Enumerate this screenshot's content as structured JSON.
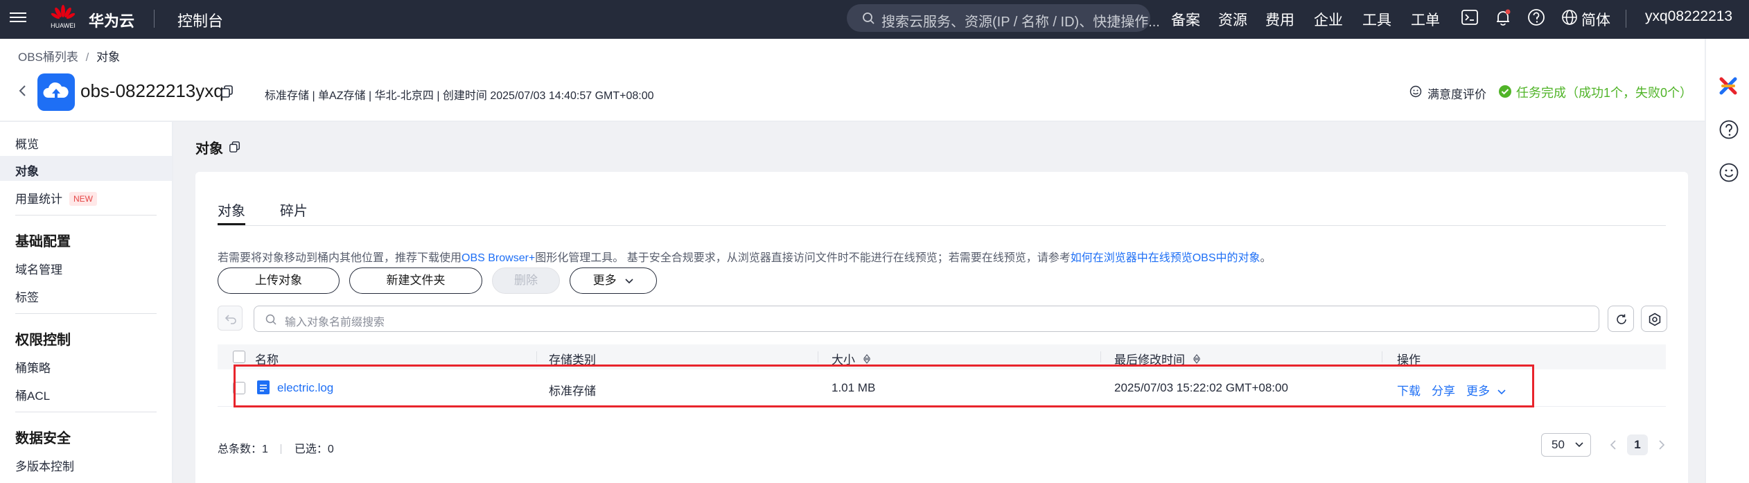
{
  "topbar": {
    "brand": "华为云",
    "logo_text": "HUAWEI",
    "console": "控制台",
    "search_placeholder": "搜索云服务、资源(IP / 名称 / ID)、快捷操作...",
    "nav": [
      "备案",
      "资源",
      "费用",
      "企业",
      "工具",
      "工单"
    ],
    "language": "简体",
    "user": "yxq08222213"
  },
  "header": {
    "breadcrumb_parent": "OBS桶列表",
    "breadcrumb_sep": "/",
    "breadcrumb_current": "对象",
    "bucket_name": "obs-08222213yxq",
    "meta": "标准存储 | 单AZ存储 | 华北-北京四 | 创建时间  2025/07/03 14:40:57 GMT+08:00",
    "satisfaction": "满意度评价",
    "task_status": "任务完成（成功1个，失败0个）"
  },
  "sidebar": {
    "items_top": [
      {
        "label": "概览"
      },
      {
        "label": "对象",
        "active": true
      },
      {
        "label": "用量统计",
        "badge": "NEW"
      }
    ],
    "groups": [
      {
        "title": "基础配置",
        "items": [
          "域名管理",
          "标签"
        ]
      },
      {
        "title": "权限控制",
        "items": [
          "桶策略",
          "桶ACL"
        ]
      },
      {
        "title": "数据安全",
        "items": [
          "多版本控制"
        ]
      }
    ]
  },
  "main": {
    "title": "对象",
    "tabs": [
      "对象",
      "碎片"
    ],
    "hint_prefix": "若需要将对象移动到桶内其他位置，推荐下载使用",
    "hint_link1": "OBS Browser+",
    "hint_middle": "图形化管理工具。 基于安全合规要求，从浏览器直接访问文件时不能进行在线预览；若需要在线预览，请参考",
    "hint_link2": "如何在浏览器中在线预览OBS中的对象",
    "hint_suffix": "。",
    "buttons": {
      "upload": "上传对象",
      "new_folder": "新建文件夹",
      "delete": "删除",
      "more": "更多"
    },
    "search_placeholder": "输入对象名前缀搜索",
    "columns": [
      "名称",
      "存储类别",
      "大小",
      "最后修改时间",
      "操作"
    ],
    "rows": [
      {
        "name": "electric.log",
        "storage_class": "标准存储",
        "size": "1.01 MB",
        "modified": "2025/07/03 15:22:02 GMT+08:00",
        "actions": [
          "下载",
          "分享",
          "更多"
        ]
      }
    ],
    "footer": {
      "total_label": "总条数：",
      "total": "1",
      "selected_label": "已选：",
      "selected": "0",
      "page_size": "50",
      "page": "1"
    }
  },
  "colors": {
    "accent": "#1e6ff5",
    "success": "#50b428",
    "highlight": "#e8242c",
    "topbar": "#252b3a"
  }
}
